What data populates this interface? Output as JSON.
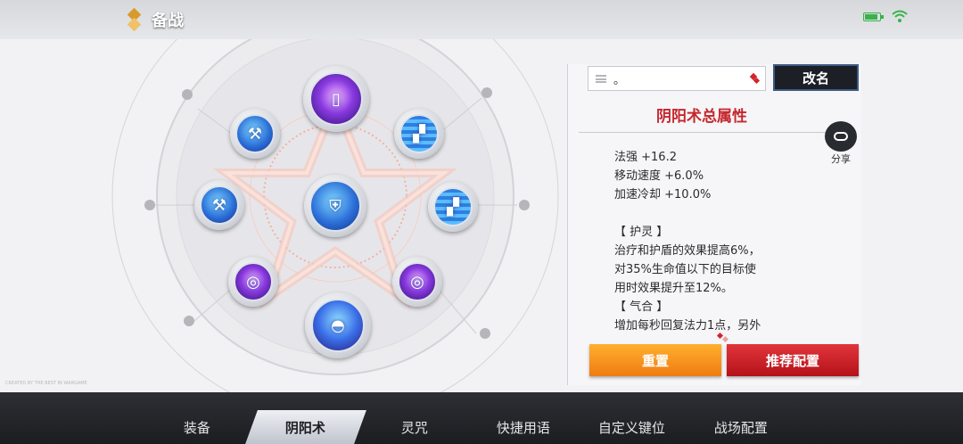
{
  "header": {
    "title": "备战",
    "icons": [
      "diamond-icon",
      "battery-icon",
      "wifi-icon"
    ]
  },
  "talent_tree": {
    "nodes": [
      {
        "id": "top",
        "icon": "card-scroll-icon",
        "glyph": "▯"
      },
      {
        "id": "upper-left",
        "icon": "hammer-icon",
        "glyph": "⚒"
      },
      {
        "id": "upper-right",
        "icon": "boot-icon",
        "glyph": "▞"
      },
      {
        "id": "middle-left",
        "icon": "hammer-icon",
        "glyph": "⚒"
      },
      {
        "id": "center",
        "icon": "shield-icon",
        "glyph": "⛨"
      },
      {
        "id": "middle-right",
        "icon": "boot-icon",
        "glyph": "▞"
      },
      {
        "id": "lower-left",
        "icon": "vortex-icon",
        "glyph": "◎"
      },
      {
        "id": "lower-right",
        "icon": "vortex-icon",
        "glyph": "◎"
      },
      {
        "id": "bottom",
        "icon": "helmet-icon",
        "glyph": "◓"
      }
    ],
    "watermark": "CREATED BY THE BEST IN WARGAME"
  },
  "right_panel": {
    "name_value": "。",
    "rename_label": "改名",
    "section_title": "阴阳术总属性",
    "share_label": "分享",
    "attributes_text": "法强 +16.2\n移动速度 +6.0%\n加速冷却 +10.0%\n\n【 护灵 】\n治疗和护盾的效果提高6%，\n对35%生命值以下的目标使\n用时效果提升至12%。\n【 气合 】\n增加每秒回复法力1点，另外",
    "reset_label": "重置",
    "recommend_label": "推荐配置"
  },
  "tabs": [
    {
      "label": "装备",
      "active": false
    },
    {
      "label": "阴阳术",
      "active": true
    },
    {
      "label": "灵咒",
      "active": false
    },
    {
      "label": "快捷用语",
      "active": false
    },
    {
      "label": "自定义键位",
      "active": false
    },
    {
      "label": "战场配置",
      "active": false
    }
  ],
  "colors": {
    "accent_red": "#c6262e",
    "reset_orange": "#f07b12",
    "recommend_red": "#b5121a",
    "tab_bar": "#1c1d21"
  }
}
